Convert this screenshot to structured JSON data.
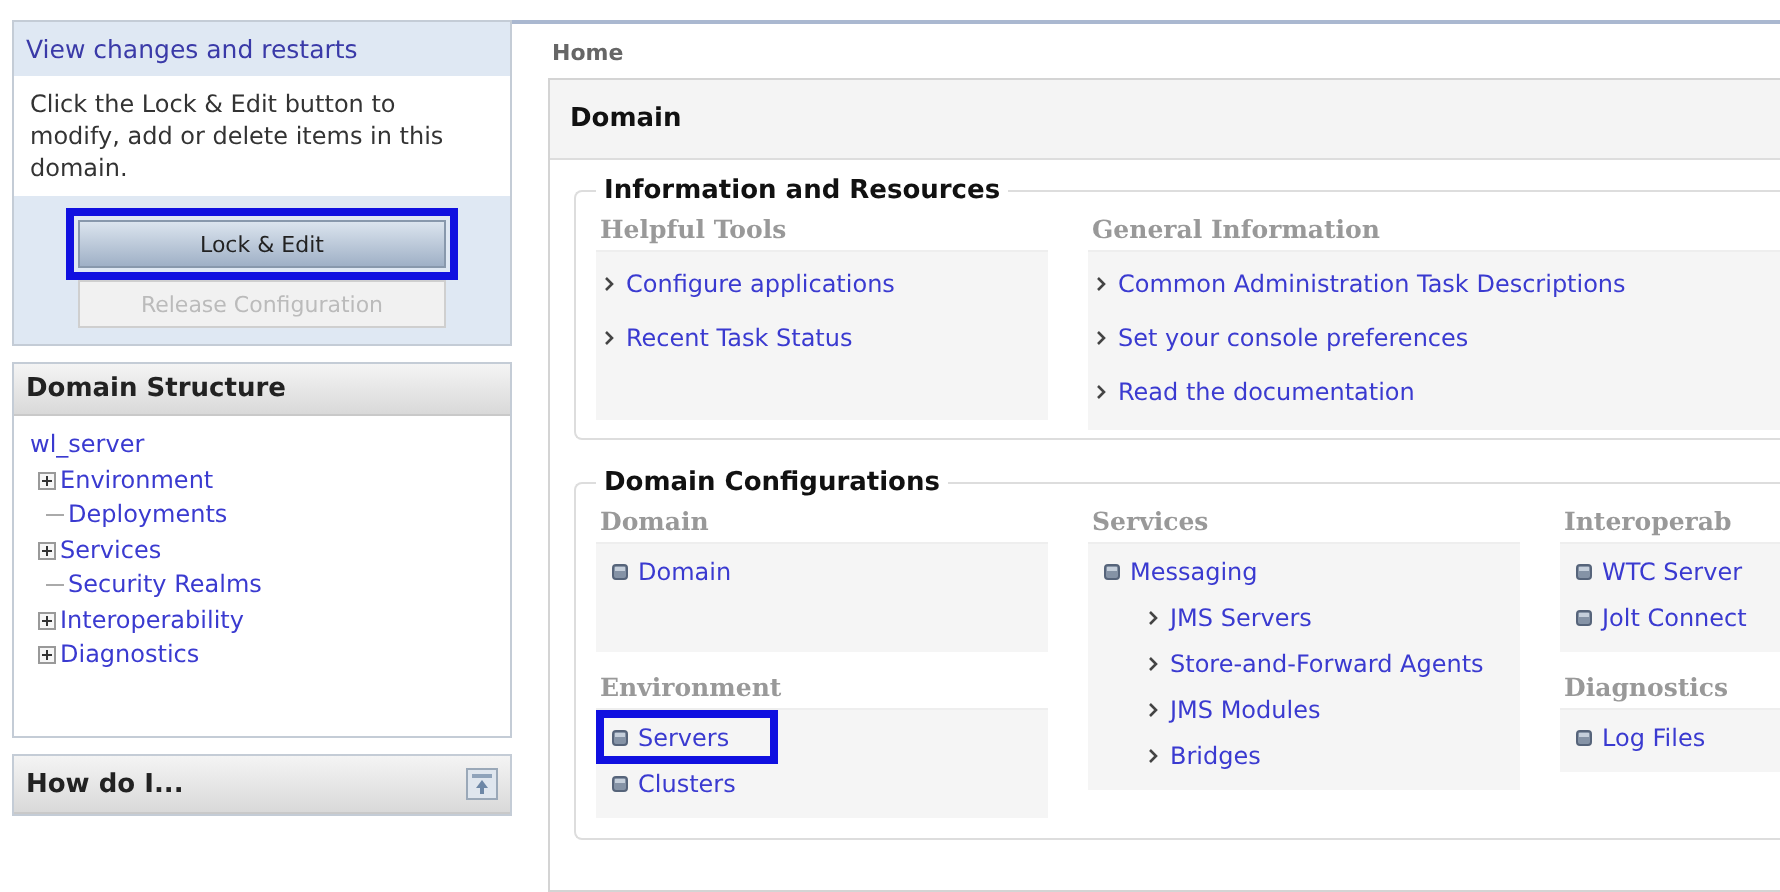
{
  "change_center": {
    "title": "View changes and restarts",
    "message": "Click the Lock & Edit button to modify, add or delete items in this domain.",
    "buttons": [
      {
        "label": "Lock & Edit",
        "disabled": false,
        "highlighted": true
      },
      {
        "label": "Release Configuration",
        "disabled": true,
        "highlighted": false
      }
    ]
  },
  "domain_structure": {
    "title": "Domain Structure",
    "root": "wl_server",
    "children": [
      {
        "label": "Environment",
        "expandable": true
      },
      {
        "label": "Deployments",
        "expandable": false
      },
      {
        "label": "Services",
        "expandable": true
      },
      {
        "label": "Security Realms",
        "expandable": false
      },
      {
        "label": "Interoperability",
        "expandable": true
      },
      {
        "label": "Diagnostics",
        "expandable": true
      }
    ]
  },
  "how_do_i": {
    "title": "How do I..."
  },
  "breadcrumb": "Home",
  "page_title": "Domain",
  "info_section": {
    "title": "Information and Resources",
    "columns": [
      {
        "heading": "Helpful Tools",
        "links": [
          "Configure applications",
          "Recent Task Status"
        ]
      },
      {
        "heading": "General Information",
        "links": [
          "Common Administration Task Descriptions",
          "Set your console preferences",
          "Read the documentation"
        ]
      }
    ]
  },
  "config_section": {
    "title": "Domain Configurations",
    "columns": [
      {
        "groups": [
          {
            "heading": "Domain",
            "items": [
              {
                "label": "Domain",
                "kind": "bullet",
                "highlighted": false
              }
            ]
          },
          {
            "heading": "Environment",
            "items": [
              {
                "label": "Servers",
                "kind": "bullet",
                "highlighted": true
              },
              {
                "label": "Clusters",
                "kind": "bullet",
                "highlighted": false
              }
            ]
          }
        ]
      },
      {
        "groups": [
          {
            "heading": "Services",
            "items": [
              {
                "label": "Messaging",
                "kind": "bullet",
                "highlighted": false
              },
              {
                "label": "JMS Servers",
                "kind": "sub",
                "highlighted": false
              },
              {
                "label": "Store-and-Forward Agents",
                "kind": "sub",
                "highlighted": false
              },
              {
                "label": "JMS Modules",
                "kind": "sub",
                "highlighted": false
              },
              {
                "label": "Bridges",
                "kind": "sub",
                "highlighted": false
              }
            ]
          }
        ]
      },
      {
        "groups": [
          {
            "heading": "Interoperab",
            "items": [
              {
                "label": "WTC Server",
                "kind": "bullet",
                "highlighted": false
              },
              {
                "label": "Jolt Connect",
                "kind": "bullet",
                "highlighted": false
              }
            ]
          },
          {
            "heading": "Diagnostics",
            "items": [
              {
                "label": "Log Files",
                "kind": "bullet",
                "highlighted": false
              }
            ]
          }
        ]
      }
    ]
  }
}
